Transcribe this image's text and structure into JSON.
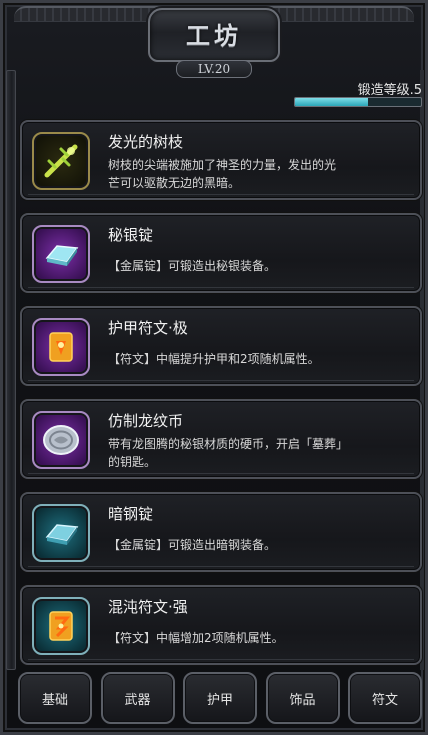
{
  "header": {
    "title": "工坊",
    "level_badge": "LV.20"
  },
  "forge": {
    "level_label": "锻造等级.5",
    "progress": 0.58
  },
  "items": [
    {
      "name": "发光的树枝",
      "desc_line1": "树枝的尖端被施加了神圣的力量，发出的光",
      "desc_line2": "芒可以驱散无边的黑暗。",
      "icon": "glowing-branch-icon",
      "frame": "gold"
    },
    {
      "name": "秘银锭",
      "desc_line1": "【金属锭】可锻造出秘银装备。",
      "desc_line2": "",
      "icon": "mithril-ingot-icon",
      "frame": "purple"
    },
    {
      "name": "护甲符文·极",
      "desc_line1": "【符文】中幅提升护甲和2项随机属性。",
      "desc_line2": "",
      "icon": "armor-rune-icon",
      "frame": "purple"
    },
    {
      "name": "仿制龙纹币",
      "desc_line1": "带有龙图腾的秘银材质的硬币，开启「墓葬」",
      "desc_line2": "的钥匙。",
      "icon": "dragon-coin-icon",
      "frame": "purple"
    },
    {
      "name": "暗钢锭",
      "desc_line1": "【金属锭】可锻造出暗钢装备。",
      "desc_line2": "",
      "icon": "dark-steel-ingot-icon",
      "frame": "teal"
    },
    {
      "name": "混沌符文·强",
      "desc_line1": "【符文】中幅增加2项随机属性。",
      "desc_line2": "",
      "icon": "chaos-rune-icon",
      "frame": "teal"
    }
  ],
  "tabs": [
    {
      "label": "基础"
    },
    {
      "label": "武器"
    },
    {
      "label": "护甲"
    },
    {
      "label": "饰品"
    },
    {
      "label": "符文"
    }
  ],
  "colors": {
    "background": "#0c0d10",
    "progress_fill": "#2aa6b8",
    "frame_border": "#4d5058"
  }
}
